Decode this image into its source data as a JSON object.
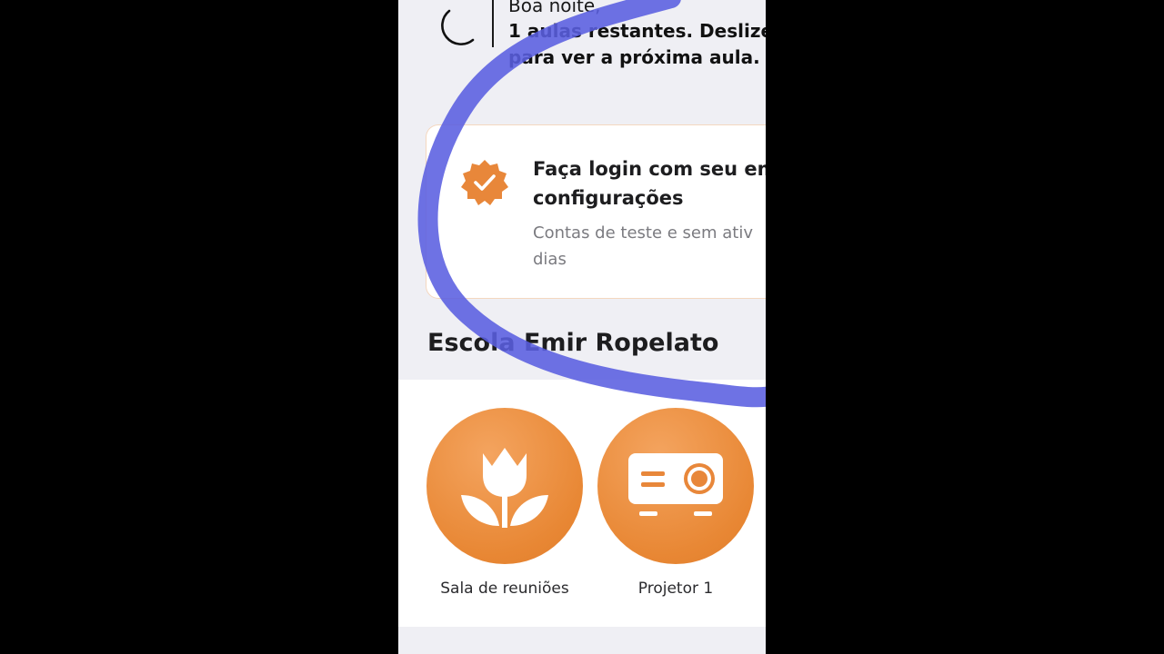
{
  "greeting": {
    "title": "Boa noite,",
    "text": "1 aulas restantes. Deslize para ver a próxima aula.",
    "icon": "moon-icon"
  },
  "login_card": {
    "icon": "verified-badge-icon",
    "title_line1": "Faça login com seu em",
    "title_line2": "configurações",
    "subtitle_line1": "Contas de teste e sem ativ",
    "subtitle_line2": "dias"
  },
  "section": {
    "title": "Escola Emir Ropelato"
  },
  "devices": [
    {
      "label": "Sala de reuniões",
      "icon": "tulip-icon"
    },
    {
      "label": "Projetor 1",
      "icon": "projector-icon"
    }
  ],
  "colors": {
    "accent": "#E8873A",
    "annotation": "#5A5FE0",
    "background": "#EFEFF4"
  }
}
